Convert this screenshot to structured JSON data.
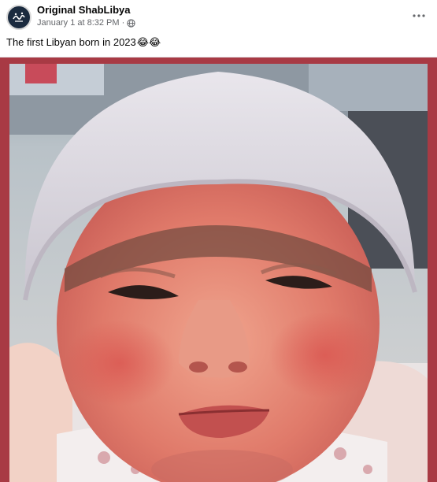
{
  "post": {
    "page_name": "Original ShabLibya",
    "timestamp": "January 1 at 8:32 PM",
    "separator": "·",
    "caption_text": "The first Libyan born in 2023",
    "caption_emoji": "😂😂",
    "avatar_icon": "page-avatar-logo",
    "audience_icon": "globe-icon",
    "more_icon": "more-options-icon"
  },
  "colors": {
    "frame": "#a83a44",
    "meta_text": "#65676b"
  }
}
